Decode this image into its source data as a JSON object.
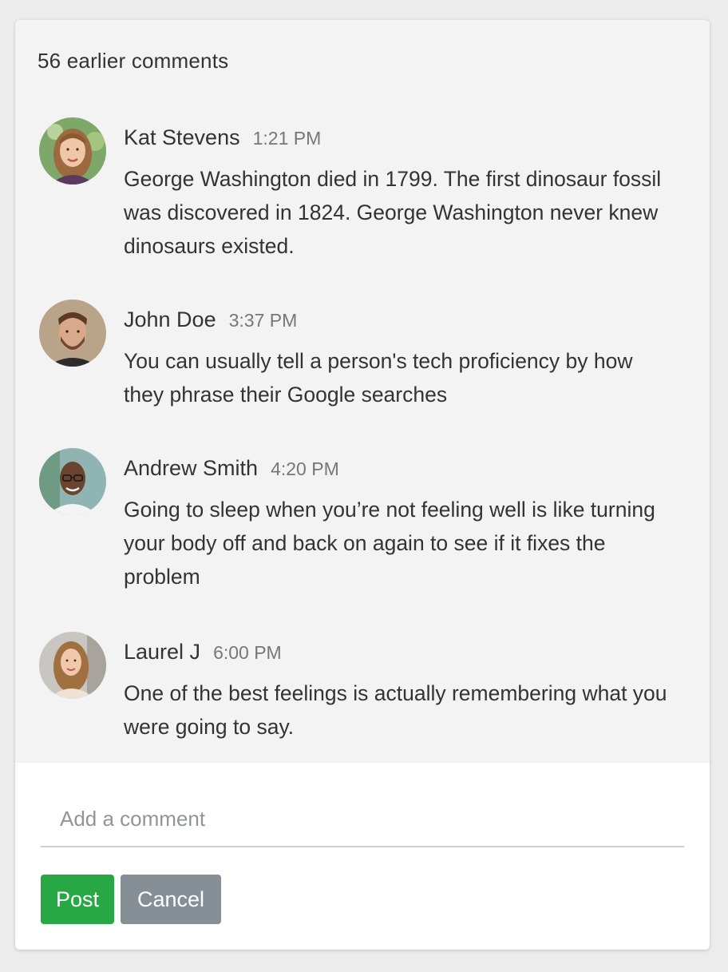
{
  "header": {
    "earlier_comments": "56 earlier comments"
  },
  "comments": [
    {
      "name": "Kat Stevens",
      "time": "1:21 PM",
      "text": "George Washington died in 1799. The first dinosaur fossil was discovered in 1824. George Washington never knew dinosaurs existed.",
      "avatar": "avatar-woman-blonde"
    },
    {
      "name": "John Doe",
      "time": "3:37 PM",
      "text": "You can usually tell a person's tech proficiency by how they phrase their Google searches",
      "avatar": "avatar-man-beard"
    },
    {
      "name": "Andrew Smith",
      "time": "4:20 PM",
      "text": "Going to sleep when you’re not feeling well is like turning your body off and back on again to see if it fixes the problem",
      "avatar": "avatar-man-glasses"
    },
    {
      "name": "Laurel J",
      "time": "6:00 PM",
      "text": "One of the best feelings is actually remembering what you were going to say.",
      "avatar": "avatar-woman-long-hair"
    }
  ],
  "composer": {
    "placeholder": "Add a comment",
    "value": "",
    "post_label": "Post",
    "cancel_label": "Cancel"
  },
  "colors": {
    "post_button": "#28a745",
    "cancel_button": "#868e96",
    "card_background": "#f3f3f3",
    "composer_background": "#ffffff"
  }
}
